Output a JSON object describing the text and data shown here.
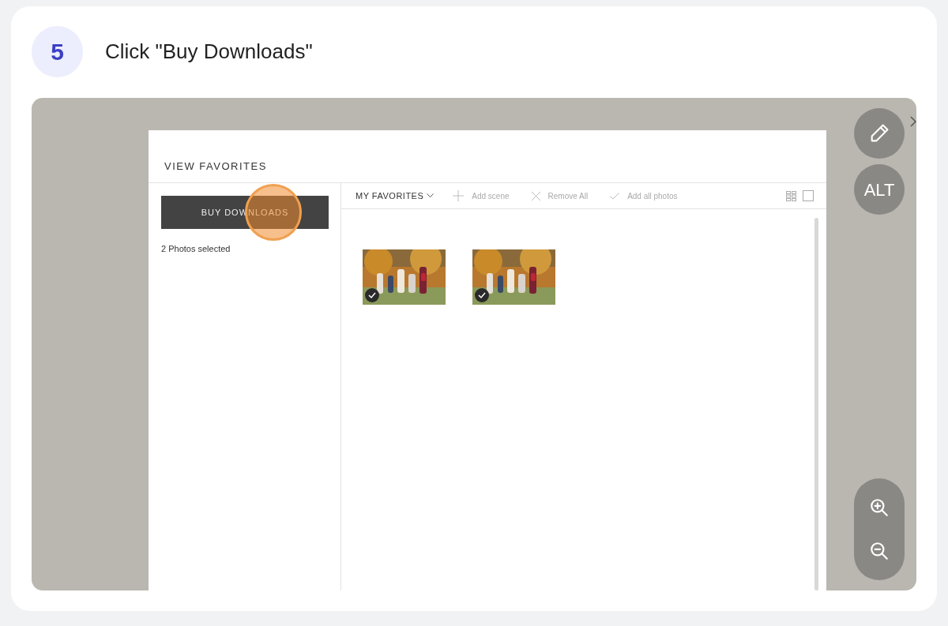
{
  "step": {
    "number": "5",
    "title": "Click \"Buy Downloads\""
  },
  "app": {
    "heading": "VIEW FAVORITES",
    "buy_button": "BUY DOWNLOADS",
    "selection_count": "2 Photos selected",
    "album_menu": "MY FAVORITES",
    "toolbar": [
      {
        "label": "Add scene",
        "kind": "add"
      },
      {
        "label": "Remove All",
        "kind": "remove"
      },
      {
        "label": "Add all photos",
        "kind": "check"
      }
    ],
    "photos": [
      {
        "kind": "picture",
        "checked": true
      },
      {
        "kind": "picture",
        "checked": true
      }
    ]
  },
  "side_controls": {
    "alt_button": "ALT"
  }
}
